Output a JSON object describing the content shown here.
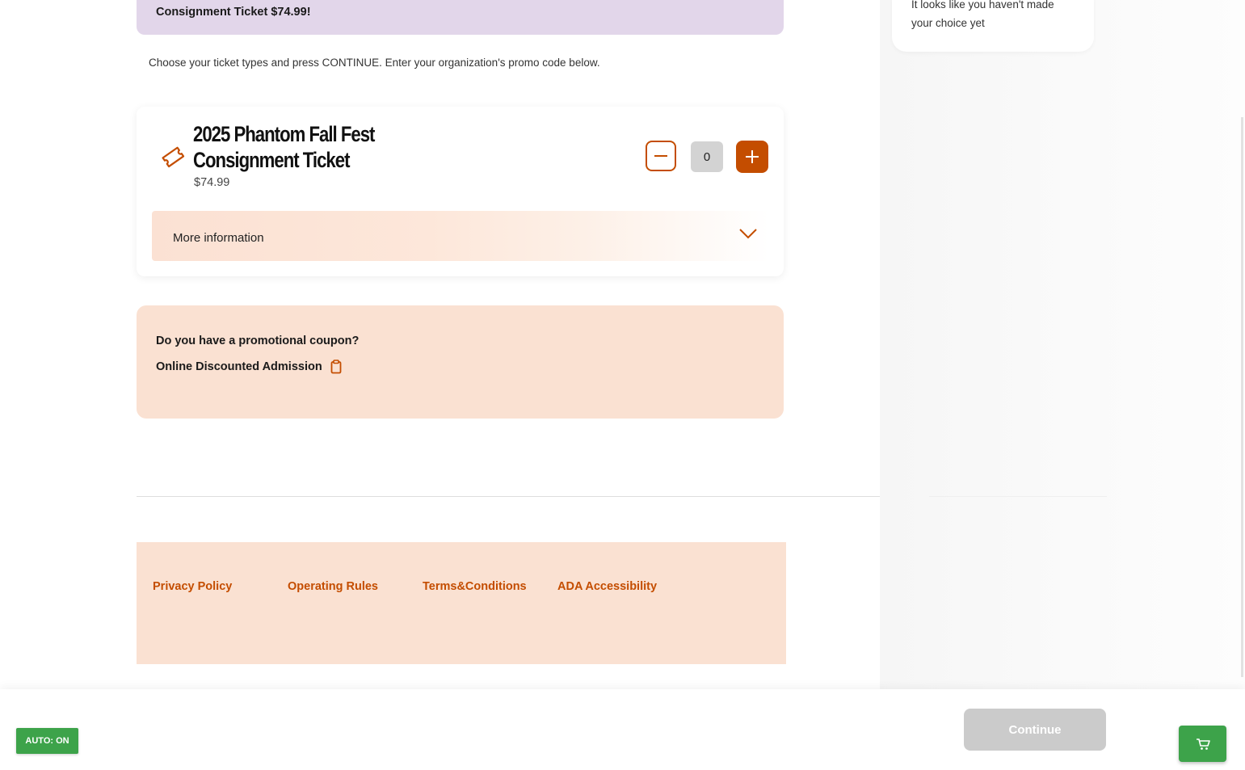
{
  "banner": {
    "text": "Consignment Ticket $74.99!"
  },
  "cart_summary": {
    "message": "It looks like you haven't made your choice yet"
  },
  "instructions": "Choose your ticket types and press CONTINUE. Enter your organization's promo code below.",
  "ticket": {
    "icon": "ticket-icon",
    "name": "2025 Phantom Fall Fest Consignment Ticket",
    "price": "$74.99",
    "quantity": "0",
    "more_info_label": "More information"
  },
  "promo": {
    "question": "Do you have a promotional coupon?",
    "code": "Online Discounted Admission",
    "copy_icon": "clipboard-icon"
  },
  "footer": {
    "links": [
      "Privacy Policy",
      "Operating Rules",
      "Terms&Conditions",
      "ADA Accessibility"
    ]
  },
  "bottom": {
    "auto_badge": "AUTO: ON",
    "continue_label": "Continue",
    "cart_icon": "cart-icon"
  },
  "colors": {
    "accent": "#c44d00",
    "banner_bg": "#e2d6ea",
    "promo_bg": "#fae1d2",
    "auto_green": "#3da34a",
    "continue_disabled": "#cbcbcb"
  }
}
